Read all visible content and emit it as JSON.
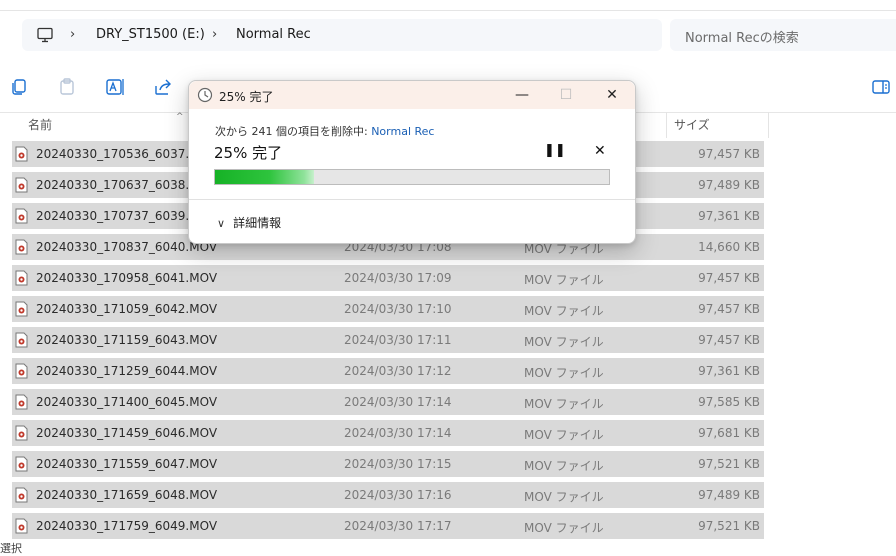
{
  "address": {
    "crumbs": [
      "DRY_ST1500 (E:)",
      "Normal Rec"
    ],
    "search_placeholder": "Normal Recの検索"
  },
  "header": {
    "name": "名前",
    "size": "サイズ"
  },
  "files": [
    {
      "name": "20240330_170536_6037.MOV",
      "date": "",
      "type": "",
      "size": "97,457 KB"
    },
    {
      "name": "20240330_170637_6038.MOV",
      "date": "",
      "type": "",
      "size": "97,489 KB"
    },
    {
      "name": "20240330_170737_6039.MOV",
      "date": "",
      "type": "",
      "size": "97,361 KB"
    },
    {
      "name": "20240330_170837_6040.MOV",
      "date": "2024/03/30 17:08",
      "type": "MOV ファイル",
      "size": "14,660 KB"
    },
    {
      "name": "20240330_170958_6041.MOV",
      "date": "2024/03/30 17:09",
      "type": "MOV ファイル",
      "size": "97,457 KB"
    },
    {
      "name": "20240330_171059_6042.MOV",
      "date": "2024/03/30 17:10",
      "type": "MOV ファイル",
      "size": "97,457 KB"
    },
    {
      "name": "20240330_171159_6043.MOV",
      "date": "2024/03/30 17:11",
      "type": "MOV ファイル",
      "size": "97,457 KB"
    },
    {
      "name": "20240330_171259_6044.MOV",
      "date": "2024/03/30 17:12",
      "type": "MOV ファイル",
      "size": "97,361 KB"
    },
    {
      "name": "20240330_171400_6045.MOV",
      "date": "2024/03/30 17:14",
      "type": "MOV ファイル",
      "size": "97,585 KB"
    },
    {
      "name": "20240330_171459_6046.MOV",
      "date": "2024/03/30 17:14",
      "type": "MOV ファイル",
      "size": "97,681 KB"
    },
    {
      "name": "20240330_171559_6047.MOV",
      "date": "2024/03/30 17:15",
      "type": "MOV ファイル",
      "size": "97,521 KB"
    },
    {
      "name": "20240330_171659_6048.MOV",
      "date": "2024/03/30 17:16",
      "type": "MOV ファイル",
      "size": "97,489 KB"
    },
    {
      "name": "20240330_171759_6049.MOV",
      "date": "2024/03/30 17:17",
      "type": "MOV ファイル",
      "size": "97,521 KB"
    }
  ],
  "status": {
    "text": "選択"
  },
  "dialog": {
    "title": "25% 完了",
    "desc_prefix": "次から 241 個の項目を削除中: ",
    "desc_link": "Normal Rec",
    "big": "25% 完了",
    "progress": 0.25,
    "pause_glyph": "❚❚",
    "cancel_glyph": "✕",
    "details_label": "詳細情報",
    "minimize_glyph": "—",
    "maximize_glyph": "☐",
    "close_glyph": "✕"
  },
  "icons": {
    "toolbar": [
      "copy-icon",
      "paste-icon",
      "rename-icon",
      "share-icon",
      "delete-icon",
      "details-icon"
    ],
    "file": "video-file-icon"
  },
  "colors": {
    "progress_green": "#16b226",
    "link_blue": "#1a5fb4",
    "row_selected": "#d9d9d9",
    "dialog_titlebar": "#fbefe9"
  }
}
